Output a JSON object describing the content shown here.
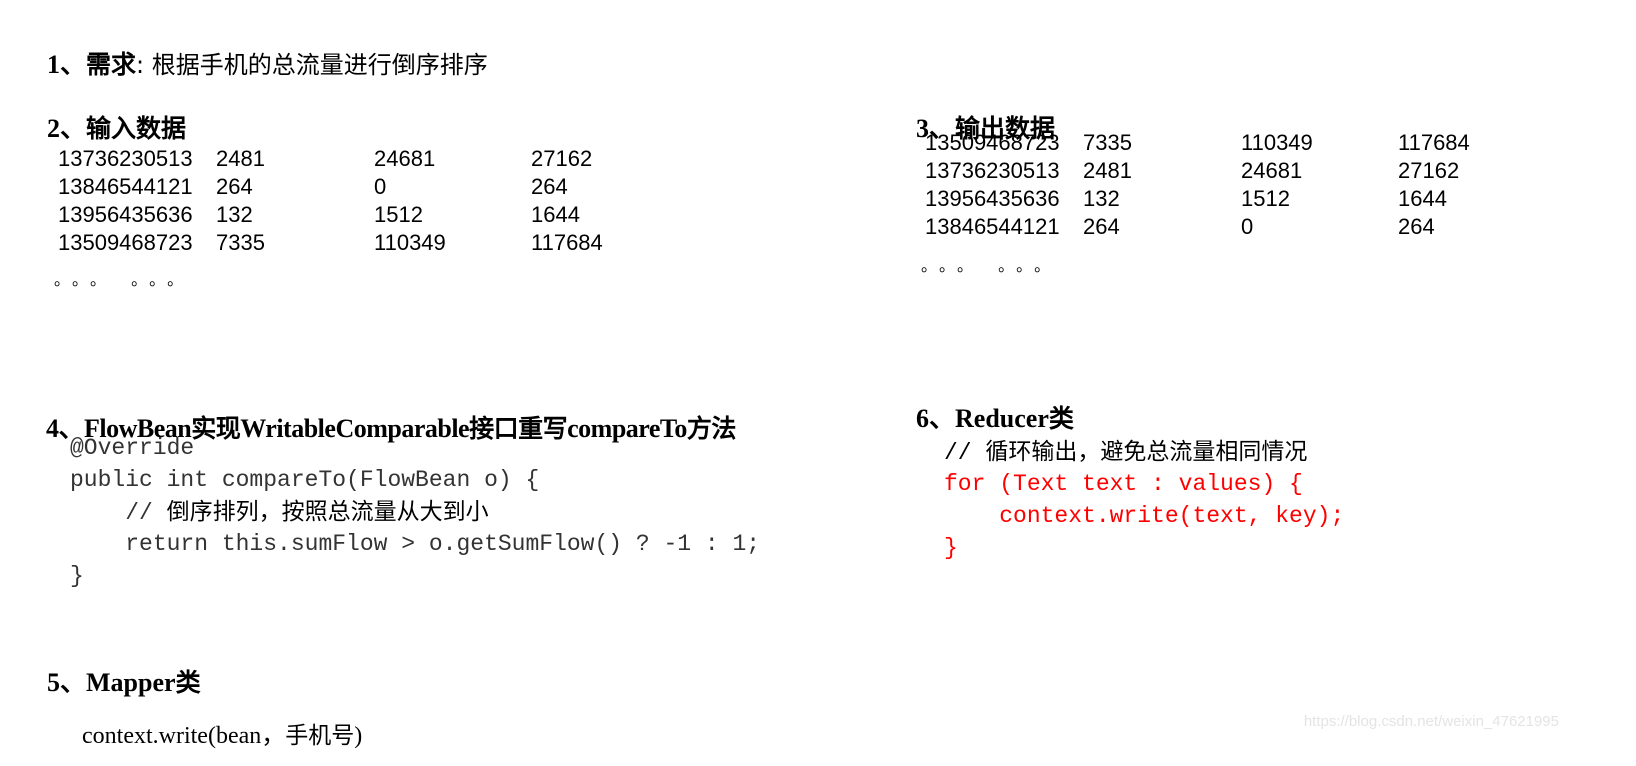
{
  "section1": {
    "number": "1、",
    "title": "需求",
    "separator": ": ",
    "text": "根据手机的总流量进行倒序排序"
  },
  "section2": {
    "number": "2、",
    "title": "输入数据",
    "rows": [
      [
        "13736230513",
        "2481",
        "24681",
        "27162"
      ],
      [
        "13846544121",
        "264",
        "0",
        "264"
      ],
      [
        "13956435636",
        "132",
        "1512",
        "1644"
      ],
      [
        "13509468723",
        "7335",
        "110349",
        "117684"
      ]
    ],
    "ellipsis": "。。。  。。。"
  },
  "section3": {
    "number": "3、",
    "title": "输出数据",
    "rows": [
      [
        "13509468723",
        "7335",
        "110349",
        "117684"
      ],
      [
        "13736230513",
        "2481",
        "24681",
        "27162"
      ],
      [
        "13956435636",
        "132",
        "1512",
        "1644"
      ],
      [
        "13846544121",
        "264",
        "0",
        "264"
      ]
    ],
    "ellipsis": "。。。  。。。"
  },
  "section4": {
    "number": "4、",
    "title_parts": [
      "FlowBean",
      "实现",
      "WritableComparable",
      "接口重写",
      "compareTo",
      "方法"
    ],
    "code": {
      "line1": "@Override",
      "line2": "public int compareTo(FlowBean o) {",
      "line3_prefix": "    // ",
      "line3_comment": "倒序排列，按照总流量从大到小",
      "line4": "    return this.sumFlow > o.getSumFlow() ? -1 : 1;",
      "line5": "}"
    }
  },
  "section5": {
    "number": "5、",
    "title_en": "Mapper",
    "title_cjk": "类",
    "code_prefix": "context.write(bean，",
    "code_cjk": "手机号",
    "code_suffix": ")"
  },
  "section6": {
    "number": "6、",
    "title_en": "Reducer",
    "title_cjk": "类",
    "code": {
      "comment_prefix": "// ",
      "comment": "循环输出，避免总流量相同情况",
      "line2": "for (Text text : values) {",
      "line3": "    context.write(text, key);",
      "line4": "}"
    }
  },
  "watermark": "https://blog.csdn.net/weixin_47621995",
  "colors": {
    "code_highlight": "#ff0000",
    "text": "#000000",
    "watermark": "#e4e4e4"
  }
}
